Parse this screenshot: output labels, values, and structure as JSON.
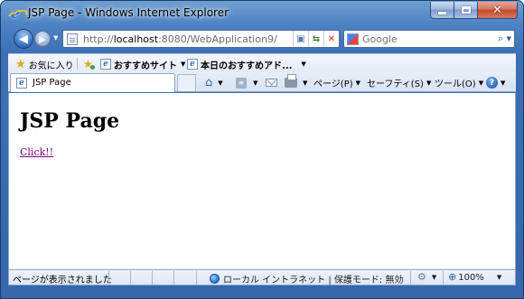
{
  "window": {
    "title": "JSP Page - Windows Internet Explorer",
    "minimize_glyph": "",
    "close_glyph": "✕"
  },
  "nav": {
    "back_glyph": "◀",
    "forward_glyph": "▶",
    "address_scheme": "http://",
    "address_host": "localhost",
    "address_rest": ":8080/WebApplication9/",
    "search_placeholder": "Google",
    "search_go_glyph": "⌕"
  },
  "favorites": {
    "favorites_label": "お気に入り",
    "items": [
      {
        "label": "おすすめサイト",
        "icon": "ie-page-icon"
      },
      {
        "label": "本日のおすすめアド...",
        "icon": "ie-page-icon"
      }
    ]
  },
  "tabs": [
    {
      "label": "JSP Page",
      "icon": "ie-page-icon"
    }
  ],
  "command_bar": {
    "page_label": "ページ(P)",
    "safety_label": "セーフティ(S)",
    "tools_label": "ツール(O)"
  },
  "page": {
    "heading": "JSP Page",
    "link_text": "Click!!"
  },
  "status": {
    "text": "ページが表示されました",
    "zone": "ローカル イントラネット | 保護モード: 無効",
    "zoom": "100%"
  },
  "colors": {
    "frame": "#4d82c3",
    "link_visited": "#800080"
  }
}
